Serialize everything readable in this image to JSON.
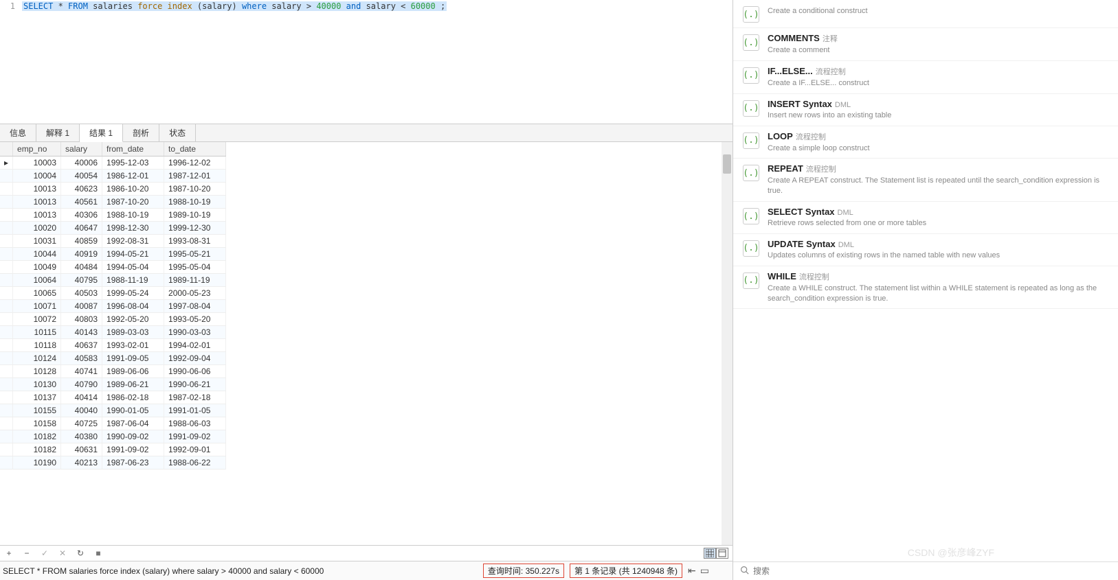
{
  "editor": {
    "line_no": "1",
    "tokens": [
      "SELECT",
      " * ",
      "FROM",
      " salaries ",
      "force index",
      " (salary) ",
      "where",
      " salary > ",
      "40000",
      " ",
      "and",
      " salary < ",
      "60000",
      " ;"
    ],
    "classes": [
      "kw",
      "txt",
      "kw",
      "txt",
      "fn",
      "txt",
      "kw",
      "txt",
      "num",
      "txt",
      "kw",
      "txt",
      "num",
      "txt"
    ]
  },
  "tabs": [
    "信息",
    "解释 1",
    "结果 1",
    "剖析",
    "状态"
  ],
  "active_tab": 2,
  "columns": [
    "emp_no",
    "salary",
    "from_date",
    "to_date"
  ],
  "rows": [
    [
      "10003",
      "40006",
      "1995-12-03",
      "1996-12-02"
    ],
    [
      "10004",
      "40054",
      "1986-12-01",
      "1987-12-01"
    ],
    [
      "10013",
      "40623",
      "1986-10-20",
      "1987-10-20"
    ],
    [
      "10013",
      "40561",
      "1987-10-20",
      "1988-10-19"
    ],
    [
      "10013",
      "40306",
      "1988-10-19",
      "1989-10-19"
    ],
    [
      "10020",
      "40647",
      "1998-12-30",
      "1999-12-30"
    ],
    [
      "10031",
      "40859",
      "1992-08-31",
      "1993-08-31"
    ],
    [
      "10044",
      "40919",
      "1994-05-21",
      "1995-05-21"
    ],
    [
      "10049",
      "40484",
      "1994-05-04",
      "1995-05-04"
    ],
    [
      "10064",
      "40795",
      "1988-11-19",
      "1989-11-19"
    ],
    [
      "10065",
      "40503",
      "1999-05-24",
      "2000-05-23"
    ],
    [
      "10071",
      "40087",
      "1996-08-04",
      "1997-08-04"
    ],
    [
      "10072",
      "40803",
      "1992-05-20",
      "1993-05-20"
    ],
    [
      "10115",
      "40143",
      "1989-03-03",
      "1990-03-03"
    ],
    [
      "10118",
      "40637",
      "1993-02-01",
      "1994-02-01"
    ],
    [
      "10124",
      "40583",
      "1991-09-05",
      "1992-09-04"
    ],
    [
      "10128",
      "40741",
      "1989-06-06",
      "1990-06-06"
    ],
    [
      "10130",
      "40790",
      "1989-06-21",
      "1990-06-21"
    ],
    [
      "10137",
      "40414",
      "1986-02-18",
      "1987-02-18"
    ],
    [
      "10155",
      "40040",
      "1990-01-05",
      "1991-01-05"
    ],
    [
      "10158",
      "40725",
      "1987-06-04",
      "1988-06-03"
    ],
    [
      "10182",
      "40380",
      "1990-09-02",
      "1991-09-02"
    ],
    [
      "10182",
      "40631",
      "1991-09-02",
      "1992-09-01"
    ],
    [
      "10190",
      "40213",
      "1987-06-23",
      "1988-06-22"
    ]
  ],
  "toolbar": {
    "plus": "+",
    "minus": "−",
    "check": "✓",
    "x": "✕",
    "refresh": "↻",
    "stop": "■"
  },
  "status": {
    "sql": "SELECT * FROM salaries force index (salary) where salary > 40000 and salary < 60000",
    "query_time": "查询时间: 350.227s",
    "records": "第 1 条记录 (共 1240948 条)"
  },
  "snippets": [
    {
      "title": "",
      "tag": "",
      "desc": "Create a conditional construct"
    },
    {
      "title": "COMMENTS",
      "tag": "注释",
      "desc": "Create a comment"
    },
    {
      "title": "IF...ELSE...",
      "tag": "流程控制",
      "desc": "Create a IF...ELSE... construct"
    },
    {
      "title": "INSERT Syntax",
      "tag": "DML",
      "desc": "Insert new rows into an existing table"
    },
    {
      "title": "LOOP",
      "tag": "流程控制",
      "desc": "Create a simple loop construct"
    },
    {
      "title": "REPEAT",
      "tag": "流程控制",
      "desc": "Create A REPEAT construct. The Statement list is repeated until the search_condition expression is true."
    },
    {
      "title": "SELECT Syntax",
      "tag": "DML",
      "desc": "Retrieve rows selected from one or more tables"
    },
    {
      "title": "UPDATE Syntax",
      "tag": "DML",
      "desc": "Updates columns of existing rows in the named table with new values"
    },
    {
      "title": "WHILE",
      "tag": "流程控制",
      "desc": "Create a WHILE construct. The statement list within a WHILE statement is repeated as long as the search_condition expression is true."
    }
  ],
  "search": {
    "placeholder": "搜索"
  },
  "watermark": "CSDN @张彦峰ZYF"
}
